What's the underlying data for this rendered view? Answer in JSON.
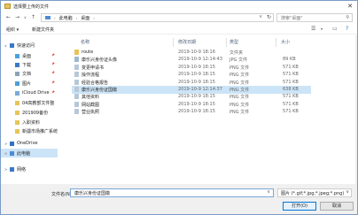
{
  "window": {
    "title": "选择要上传的文件"
  },
  "address": {
    "crumbs": [
      "此电脑",
      "桌面"
    ],
    "search_placeholder": "搜索\"桌面\""
  },
  "toolbar": {
    "organize": "组织 ▾",
    "new_folder": "新建文件夹"
  },
  "nav": {
    "items": [
      {
        "label": "快速访问",
        "icon": "star-icon",
        "color": "#3a78c8",
        "pinned": false,
        "chev": "∨"
      },
      {
        "label": "桌面",
        "icon": "desktop-icon",
        "color": "#4aa3df",
        "pinned": true
      },
      {
        "label": "下载",
        "icon": "download-icon",
        "color": "#3a78c8",
        "pinned": true
      },
      {
        "label": "文档",
        "icon": "document-icon",
        "color": "#8da2b8",
        "pinned": true
      },
      {
        "label": "图片",
        "icon": "picture-icon",
        "color": "#4f9ed8",
        "pinned": true
      },
      {
        "label": "iCloud Drive",
        "icon": "cloud-icon",
        "color": "#7aaad8",
        "pinned": true
      },
      {
        "label": "04高教部文件整",
        "icon": "folder-icon",
        "color": "#e8c35a",
        "pinned": false
      },
      {
        "label": "201909备份",
        "icon": "folder-icon",
        "color": "#e8c35a",
        "pinned": false
      },
      {
        "label": "入职资料",
        "icon": "folder-icon",
        "color": "#e8c35a",
        "pinned": false
      },
      {
        "label": "新疆市场推广系统",
        "icon": "folder-icon",
        "color": "#e8c35a",
        "pinned": false
      },
      {
        "label": "OneDrive",
        "icon": "onedrive-icon",
        "color": "#2f73c2",
        "pinned": false,
        "chev": ">"
      },
      {
        "label": "此电脑",
        "icon": "computer-icon",
        "color": "#4d8bd3",
        "pinned": false,
        "chev": ">",
        "selected": true
      },
      {
        "label": "网络",
        "icon": "network-icon",
        "color": "#3a78c8",
        "pinned": false,
        "chev": ">"
      }
    ]
  },
  "columns": {
    "name": "名称",
    "date": "修改日期",
    "type": "类型",
    "size": "大小"
  },
  "files": [
    {
      "name": "route",
      "date": "2019-10-9 18:16",
      "type": "文件夹",
      "size": "",
      "icon": "folder-icon",
      "selected": false
    },
    {
      "name": "康乐兴身份证头像",
      "date": "2019-10-9 12:14:43",
      "type": "JPG 文件",
      "size": "89 KB",
      "icon": "jpg-file-icon",
      "selected": false
    },
    {
      "name": "变更申请书",
      "date": "2019-10-9 18:15",
      "type": "PNG 文件",
      "size": "571 KB",
      "icon": "png-file-icon",
      "selected": false
    },
    {
      "name": "操作流程",
      "date": "2019-10-9 18:15",
      "type": "PNG 文件",
      "size": "571 KB",
      "icon": "png-file-icon",
      "selected": false
    },
    {
      "name": "经验合格报告",
      "date": "2019-10-9 18:15",
      "type": "PNG 文件",
      "size": "571 KB",
      "icon": "png-file-icon",
      "selected": false
    },
    {
      "name": "康乐兴身份证国徽",
      "date": "2019-10-9 12:14:37",
      "type": "PNG 文件",
      "size": "638 KB",
      "icon": "png-file-icon",
      "selected": true
    },
    {
      "name": "其他资料",
      "date": "2019-10-9 18:15",
      "type": "PNG 文件",
      "size": "571 KB",
      "icon": "png-file-icon",
      "selected": false
    },
    {
      "name": "网站截图",
      "date": "2019-10-9 18:15",
      "type": "PNG 文件",
      "size": "571 KB",
      "icon": "png-file-icon",
      "selected": false
    },
    {
      "name": "营业执照",
      "date": "2019-10-9 18:15",
      "type": "PNG 文件",
      "size": "571 KB",
      "icon": "png-file-icon",
      "selected": false
    }
  ],
  "footer": {
    "filename_label": "文件名(N):",
    "filename_value": "康乐兴身份证国徽",
    "filter": "图片 (*.gif;*.jpg;*.jpeg;*.png)",
    "open": "打开(O)",
    "cancel": "取消"
  }
}
